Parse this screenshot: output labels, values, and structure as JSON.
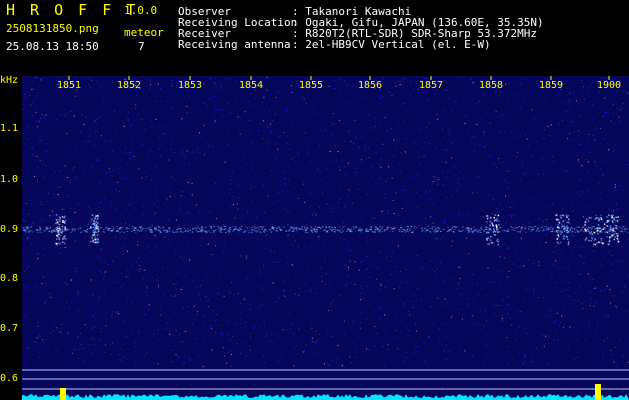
{
  "app": {
    "logo_text": "H R O F F T",
    "version": "1.0.0"
  },
  "file": {
    "name": "2508131850.png",
    "datetime": "25.08.13 18:50"
  },
  "meteor": {
    "label": "meteor",
    "count": "7"
  },
  "info": {
    "labels": [
      "Observer",
      "Receiving Location",
      "Receiver",
      "Receiving antenna"
    ],
    "values": [
      ": Takanori Kawachi",
      ": Ogaki, Gifu, JAPAN (136.60E, 35.35N)",
      ": R820T2(RTL-SDR) SDR-Sharp 53.372MHz",
      ": 2el-HB9CV Vertical (el. E-W)"
    ]
  },
  "spectrogram": {
    "y_unit": "kHz",
    "y_ticks": [
      "1.1",
      "1.0",
      "0.9",
      "0.8",
      "0.7",
      "0.6"
    ],
    "x_ticks": [
      "1851",
      "1852",
      "1853",
      "1854",
      "1855",
      "1856",
      "1857",
      "1858",
      "1859",
      "1900"
    ],
    "colors": {
      "background": "#06065a",
      "noise": "#1a3cff",
      "signal": "#6ea8ff",
      "baseline": "#00e5ff",
      "burst": "#ffff00",
      "grid": "#ffff00"
    }
  }
}
